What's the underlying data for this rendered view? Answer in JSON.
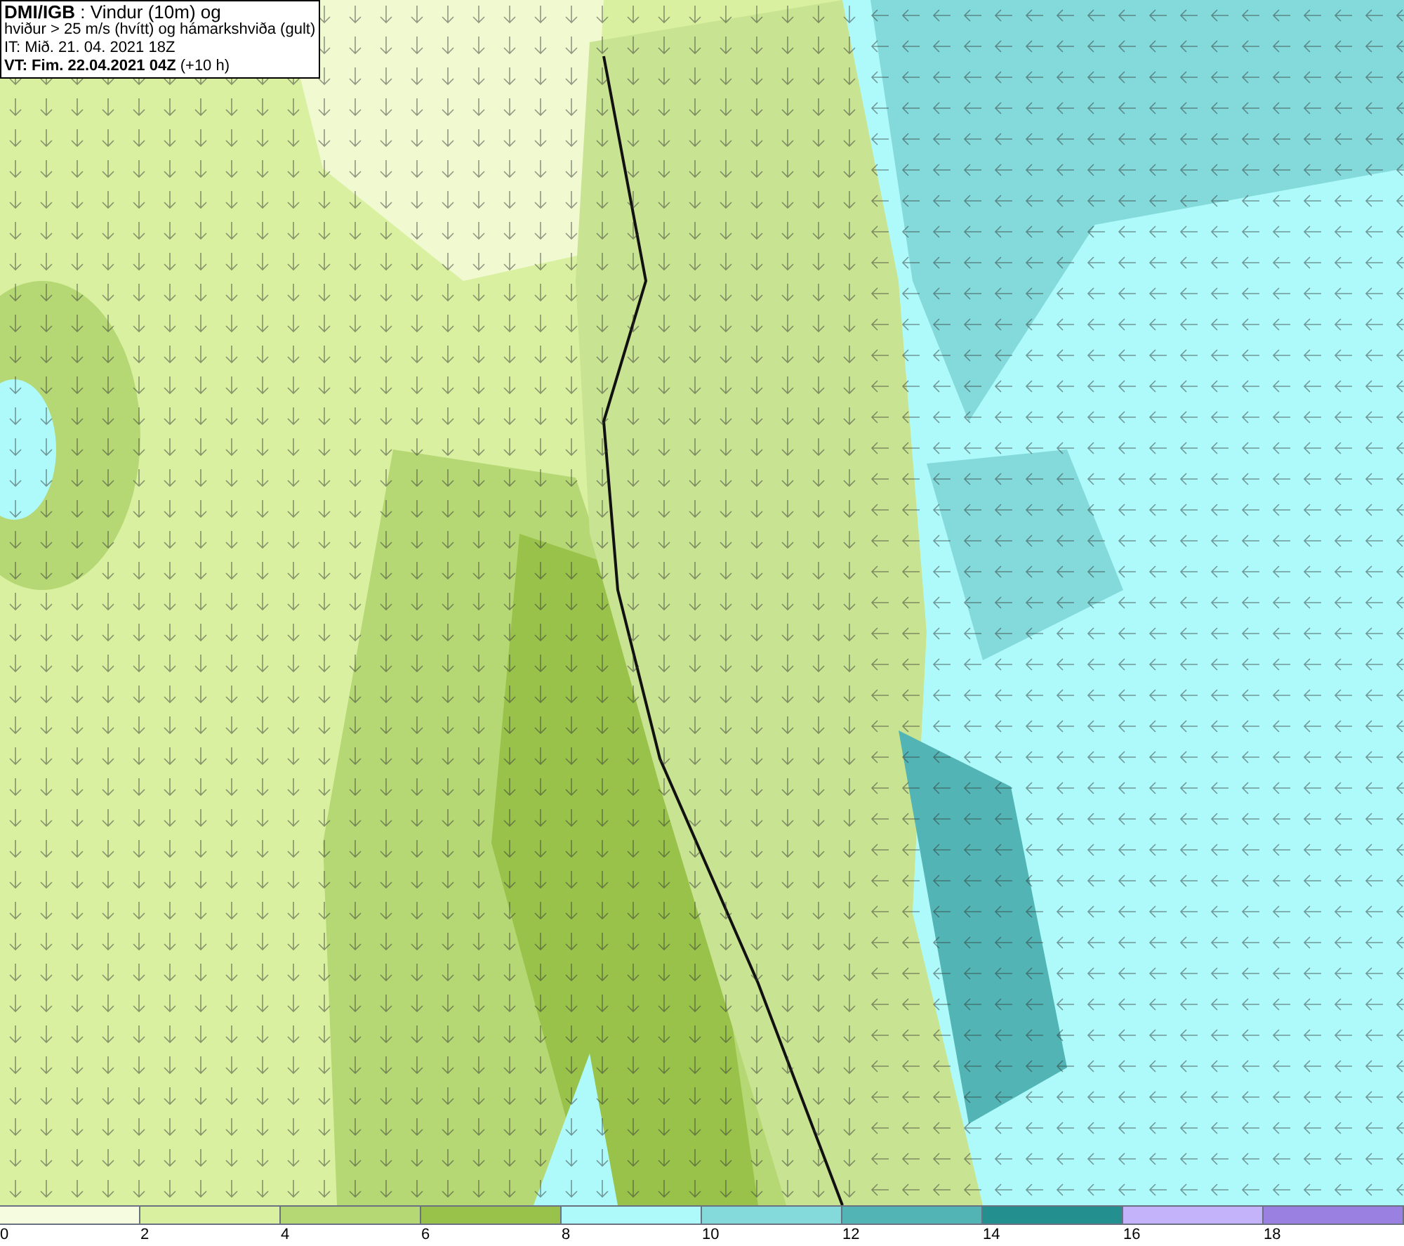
{
  "header": {
    "lines": [
      "**DMI/IGB** : Vindur (10m) og",
      "hviður > 25 m/s (hvítt) og hámarkshviða (gult)",
      "IT: Mið. 21. 04. 2021 18Z",
      "**VT: Fim. 22.04.2021 04Z** (+10 h)"
    ]
  },
  "legend": {
    "segments": [
      {
        "label": "0",
        "color": "#f5fce0"
      },
      {
        "label": "2",
        "color": "#d8f0a0"
      },
      {
        "label": "4",
        "color": "#b6d874"
      },
      {
        "label": "6",
        "color": "#99c24a"
      },
      {
        "label": "8",
        "color": "#aefafa"
      },
      {
        "label": "10",
        "color": "#84dada"
      },
      {
        "label": "12",
        "color": "#52b4b4"
      },
      {
        "label": "14",
        "color": "#248f8f"
      },
      {
        "label": "16",
        "color": "#c4b2fa"
      },
      {
        "label": "18",
        "color": "#9a80e0"
      }
    ]
  }
}
